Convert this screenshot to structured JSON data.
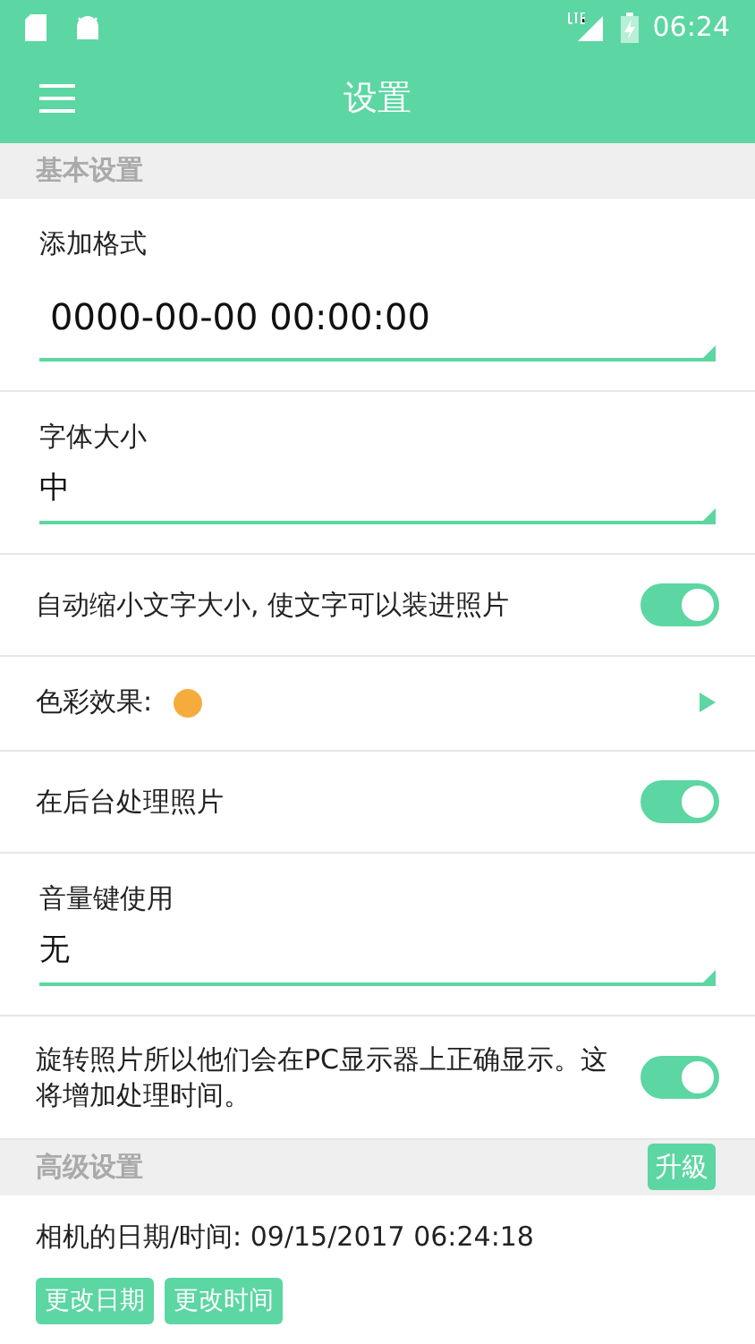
{
  "status_bar": {
    "time": "06:24"
  },
  "toolbar": {
    "title": "设置"
  },
  "sections": [
    {
      "header": "基本设置",
      "items": [
        {
          "kind": "field",
          "label": "添加格式",
          "value": "0000-00-00 00:00:00",
          "large": true
        },
        {
          "kind": "field",
          "label": "字体大小",
          "value": "中",
          "large": false
        },
        {
          "kind": "toggle",
          "label": "自动缩小文字大小, 使文字可以装进照片",
          "on": true
        },
        {
          "kind": "color",
          "label": "色彩效果:",
          "color": "#f5ac3d"
        },
        {
          "kind": "toggle",
          "label": "在后台处理照片",
          "on": true
        },
        {
          "kind": "field",
          "label": "音量键使用",
          "value": "无",
          "large": false
        },
        {
          "kind": "toggle",
          "label": "旋转照片所以他们会在PC显示器上正确显示。这将增加处理时间。",
          "on": true
        }
      ]
    },
    {
      "header": "高级设置",
      "badge": "升級",
      "items": [
        {
          "kind": "text",
          "label": "相机的日期/时间: 09/15/2017 06:24:18"
        },
        {
          "kind": "buttons",
          "buttons": [
            "更改日期",
            "更改时间"
          ]
        }
      ]
    }
  ]
}
